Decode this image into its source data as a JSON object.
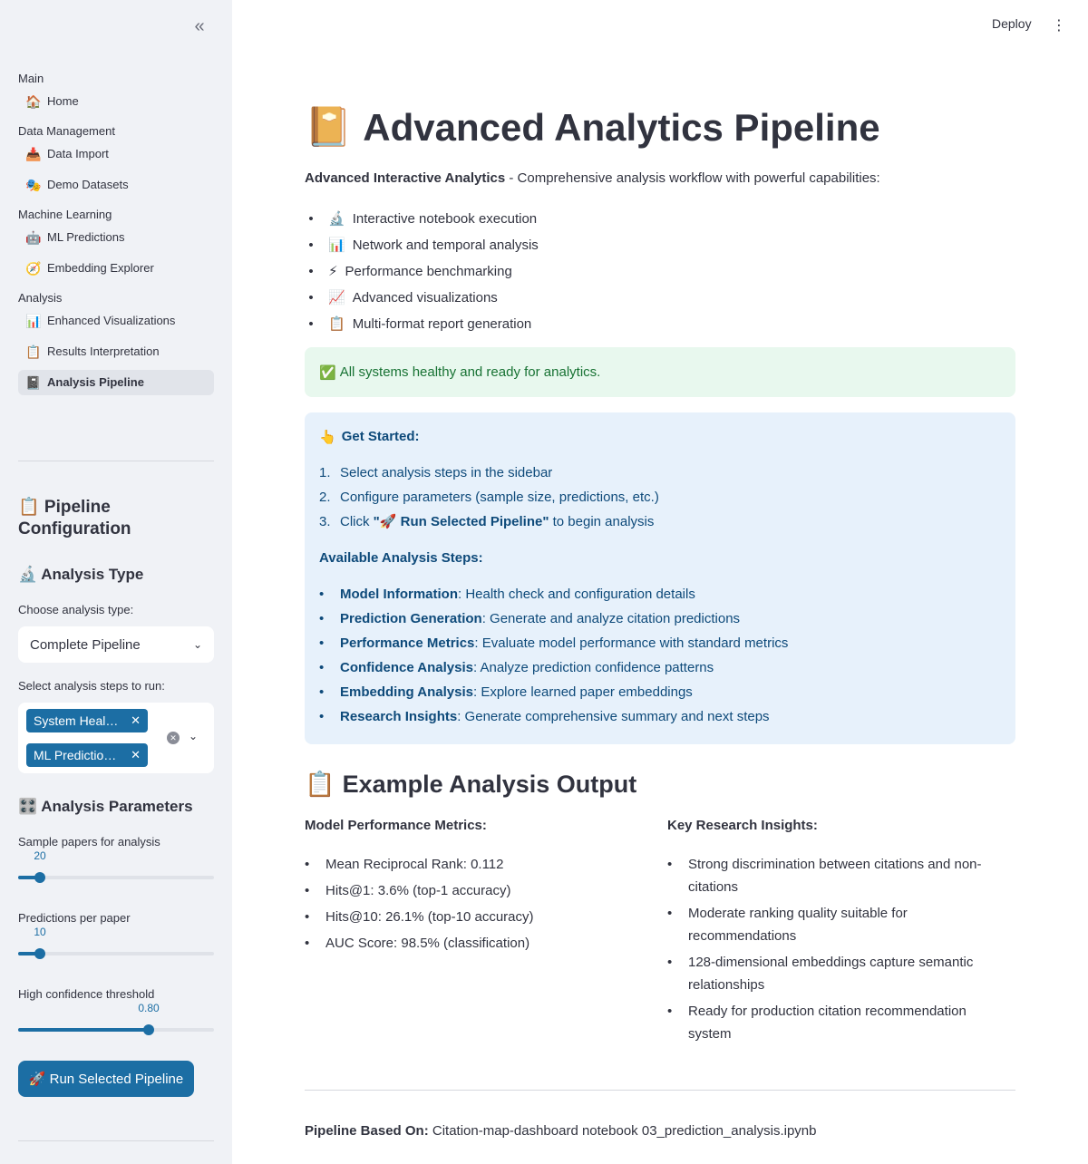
{
  "header": {
    "deploy_label": "Deploy",
    "menu_icon": "more-vertical-icon"
  },
  "sidebar": {
    "collapse_icon": "«",
    "sections": [
      {
        "title": "Main",
        "items": [
          {
            "icon": "🏠",
            "label": "Home"
          }
        ]
      },
      {
        "title": "Data Management",
        "items": [
          {
            "icon": "📥",
            "label": "Data Import"
          },
          {
            "icon": "🎭",
            "label": "Demo Datasets"
          }
        ]
      },
      {
        "title": "Machine Learning",
        "items": [
          {
            "icon": "🤖",
            "label": "ML Predictions"
          },
          {
            "icon": "🧭",
            "label": "Embedding Explorer"
          }
        ]
      },
      {
        "title": "Analysis",
        "items": [
          {
            "icon": "📊",
            "label": "Enhanced Visualizations"
          },
          {
            "icon": "📋",
            "label": "Results Interpretation"
          },
          {
            "icon": "📓",
            "label": "Analysis Pipeline",
            "active": true
          }
        ]
      }
    ],
    "config_title": "📋 Pipeline Configuration",
    "analysis_type_title": "🔬 Analysis Type",
    "choose_label": "Choose analysis type:",
    "choose_value": "Complete Pipeline",
    "steps_label": "Select analysis steps to run:",
    "steps_tags": [
      "System Heal…",
      "ML Predictio…"
    ],
    "params_title": "🎛️ Analysis Parameters",
    "sample_label": "Sample papers for analysis",
    "sample_value": "20",
    "sample_fraction": 0.11,
    "pred_label": "Predictions per paper",
    "pred_value": "10",
    "pred_fraction": 0.11,
    "conf_label": "High confidence threshold",
    "conf_value": "0.80",
    "conf_fraction": 0.667,
    "run_label": "🚀 Run Selected Pipeline"
  },
  "main": {
    "title_icon": "📔",
    "title": "Advanced Analytics Pipeline",
    "intro_bold": "Advanced Interactive Analytics",
    "intro_rest": " - Comprehensive analysis workflow with powerful capabilities:",
    "features": [
      {
        "icon": "🔬",
        "text": "Interactive notebook execution"
      },
      {
        "icon": "📊",
        "text": "Network and temporal analysis"
      },
      {
        "icon": "⚡",
        "text": "Performance benchmarking"
      },
      {
        "icon": "📈",
        "text": "Advanced visualizations"
      },
      {
        "icon": "📋",
        "text": "Multi-format report generation"
      }
    ],
    "success_icon": "✅",
    "success_text": "All systems healthy and ready for analytics.",
    "get_started_icon": "👆",
    "get_started": "Get Started:",
    "steps": [
      {
        "num": "1.",
        "pre": "Select analysis steps in the sidebar",
        "bold": "",
        "post": ""
      },
      {
        "num": "2.",
        "pre": "Configure parameters (sample size, predictions, etc.)",
        "bold": "",
        "post": ""
      },
      {
        "num": "3.",
        "pre": "Click ",
        "bold": "\"🚀 Run Selected Pipeline\"",
        "post": " to begin analysis"
      }
    ],
    "available_title": "Available Analysis Steps:",
    "available": [
      {
        "bold": "Model Information",
        "text": ": Health check and configuration details"
      },
      {
        "bold": "Prediction Generation",
        "text": ": Generate and analyze citation predictions"
      },
      {
        "bold": "Performance Metrics",
        "text": ": Evaluate model performance with standard metrics"
      },
      {
        "bold": "Confidence Analysis",
        "text": ": Analyze prediction confidence patterns"
      },
      {
        "bold": "Embedding Analysis",
        "text": ": Explore learned paper embeddings"
      },
      {
        "bold": "Research Insights",
        "text": ": Generate comprehensive summary and next steps"
      }
    ],
    "example_icon": "📋",
    "example_title": "Example Analysis Output",
    "metrics_title": "Model Performance Metrics:",
    "metrics": [
      "Mean Reciprocal Rank: 0.112",
      "Hits@1: 3.6% (top-1 accuracy)",
      "Hits@10: 26.1% (top-10 accuracy)",
      "AUC Score: 98.5% (classification)"
    ],
    "insights_title": "Key Research Insights:",
    "insights": [
      "Strong discrimination between citations and non-citations",
      "Moderate ranking quality suitable for recommendations",
      "128-dimensional embeddings capture semantic relationships",
      "Ready for production citation recommendation system"
    ],
    "footer_bold": "Pipeline Based On:",
    "footer_text": " Citation-map-dashboard notebook 03_prediction_analysis.ipynb"
  }
}
